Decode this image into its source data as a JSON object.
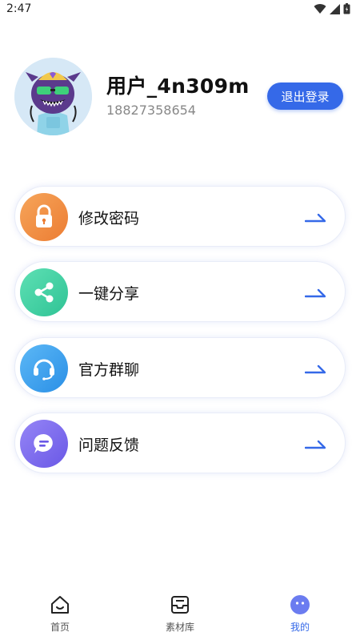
{
  "status_bar": {
    "time": "2:47"
  },
  "profile": {
    "username": "用户_4n309m",
    "phone": "18827358654",
    "logout_label": "退出登录"
  },
  "menu": {
    "items": [
      {
        "label": "修改密码",
        "icon": "lock-icon",
        "color": "#f0893e"
      },
      {
        "label": "一键分享",
        "icon": "share-icon",
        "color": "#3fd0a0"
      },
      {
        "label": "官方群聊",
        "icon": "headset-icon",
        "color": "#3aa3f0"
      },
      {
        "label": "问题反馈",
        "icon": "chat-icon",
        "color": "#7b6cf0"
      }
    ]
  },
  "tabbar": {
    "items": [
      {
        "label": "首页",
        "icon": "home-icon"
      },
      {
        "label": "素材库",
        "icon": "inbox-icon"
      },
      {
        "label": "我的",
        "icon": "profile-face-icon",
        "active": true
      }
    ]
  },
  "colors": {
    "accent": "#3569e8"
  }
}
